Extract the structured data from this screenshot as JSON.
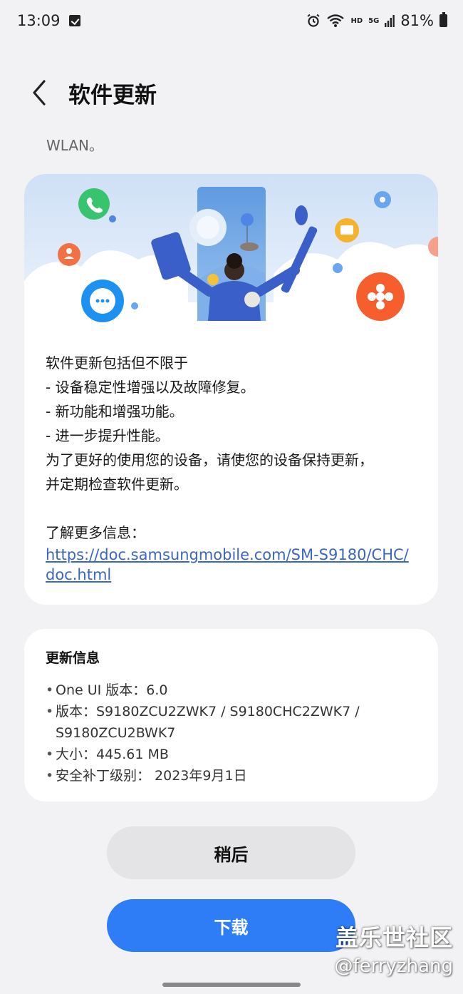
{
  "status_bar": {
    "time": "13:09",
    "network_tag": "HD",
    "signal_tag": "5G",
    "battery": "81%"
  },
  "header": {
    "title": "软件更新"
  },
  "wlan_note": "WLAN。",
  "description": {
    "lines": [
      "软件更新包括但不限于",
      "- 设备稳定性增强以及故障修复。",
      "- 新功能和增强功能。",
      "- 进一步提升性能。",
      "为了更好的使用您的设备，请使您的设备保持更新，",
      "并定期检查软件更新。"
    ],
    "more_info_label": "了解更多信息：",
    "link_text": "https://doc.samsungmobile.com/SM-S9180/CHC/doc.html"
  },
  "update_info": {
    "title": "更新信息",
    "items": [
      "One UI 版本：6.0",
      "版本：S9180ZCU2ZWK7 / S9180CHC2ZWK7 / S9180ZCU2BWK7",
      "大小：445.61 MB",
      "安全补丁级别： 2023年9月1日"
    ]
  },
  "buttons": {
    "later": "稍后",
    "download": "下载"
  },
  "watermark": {
    "line1": "盖乐世社区",
    "line2": "@ferryzhang"
  },
  "colors": {
    "accent": "#2f7df6",
    "link": "#3a66c4",
    "background": "#f2f2f4"
  }
}
